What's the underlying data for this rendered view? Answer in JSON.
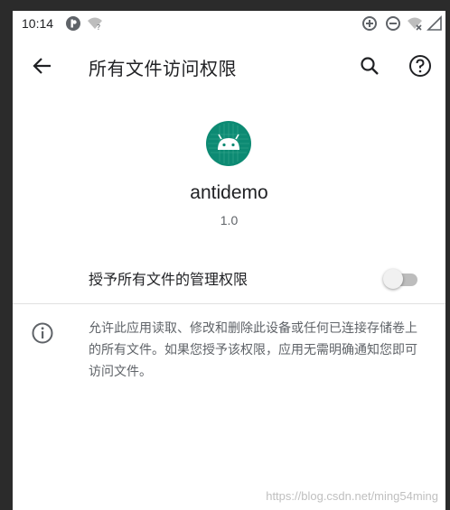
{
  "status_bar": {
    "time": "10:14"
  },
  "app_bar": {
    "title": "所有文件访问权限"
  },
  "app": {
    "name": "antidemo",
    "version": "1.0",
    "icon_color": "#0d8a73"
  },
  "permission": {
    "label": "授予所有文件的管理权限",
    "enabled": false
  },
  "info": {
    "text": "允许此应用读取、修改和删除此设备或任何已连接存储卷上的所有文件。如果您授予该权限，应用无需明确通知您即可访问文件。"
  },
  "watermark": {
    "text": "https://blog.csdn.net/ming54ming"
  }
}
